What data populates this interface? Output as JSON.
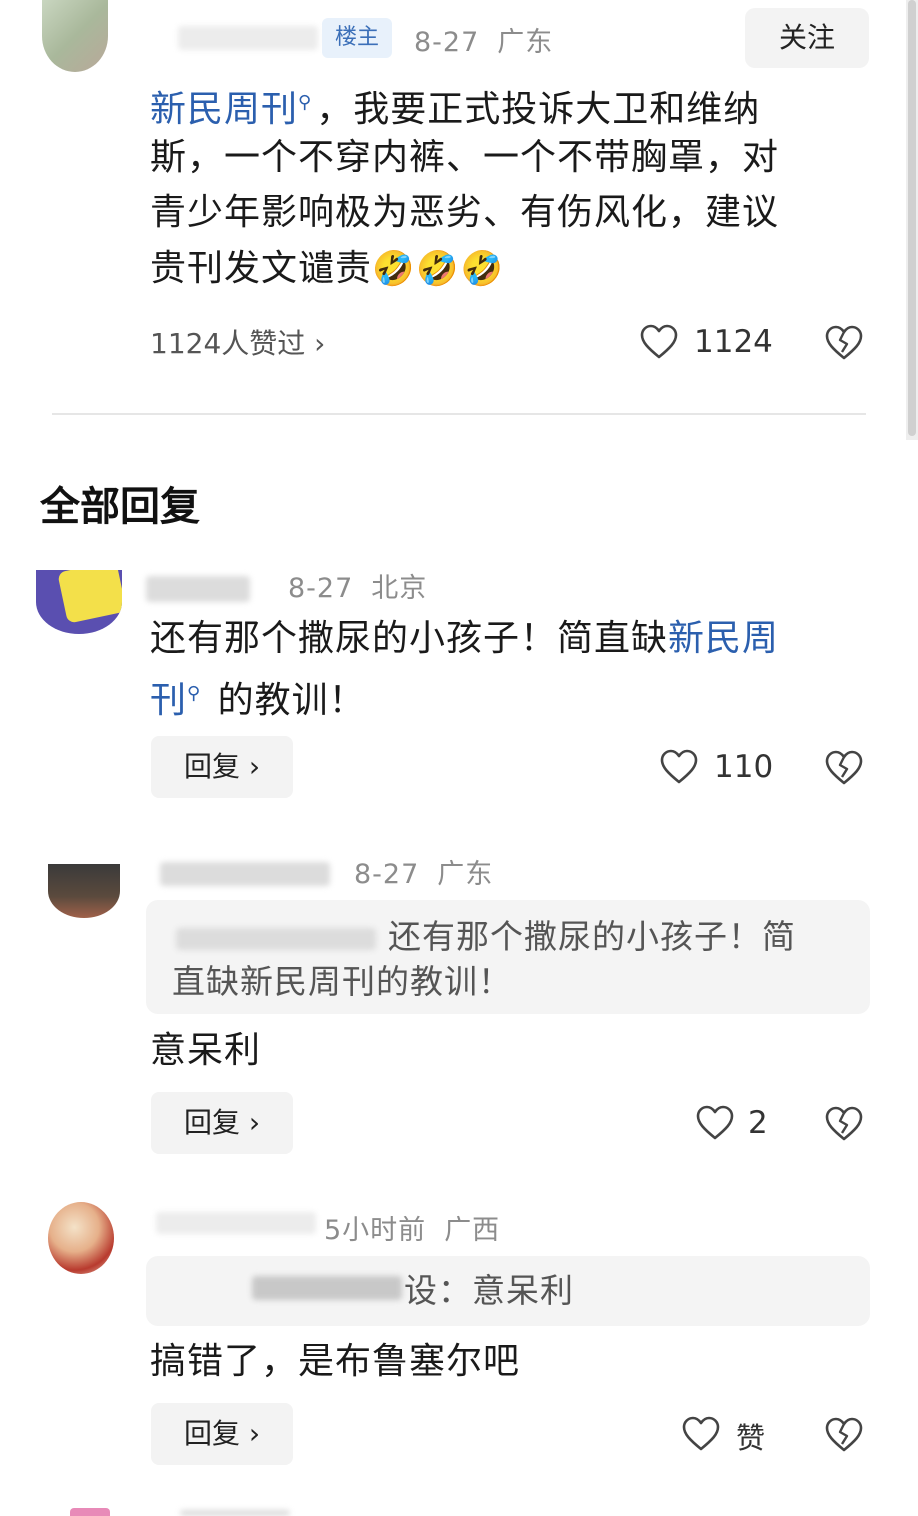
{
  "post": {
    "badge": "楼主",
    "date": "8-27",
    "location": "广东",
    "follow_label": "关注",
    "mention": "新民周刊",
    "text_after_mention": "，我要正式投诉大卫和维纳",
    "line2": "斯，一个不穿内裤、一个不带胸罩，对",
    "line3": "青少年影响极为恶劣、有伤风化，建议",
    "line4": "贵刊发文谴责",
    "emojis": "🤣🤣🤣",
    "likers_label": "1124人赞过 ›",
    "like_count": "1124"
  },
  "section_title": "全部回复",
  "replies": [
    {
      "date": "8-27",
      "location": "北京",
      "text_before": "还有那个撒尿的小孩子！简直缺",
      "mention_part1": "新民周",
      "mention_part2": "刊",
      "text_after": " 的教训！",
      "reply_label": "回复 ›",
      "like_count": "110"
    },
    {
      "date": "8-27",
      "location": "广东",
      "quote_line1": "还有那个撒尿的小孩子！简",
      "quote_line2": "直缺新民周刊的教训！",
      "text": "意呆利",
      "reply_label": "回复 ›",
      "like_count": "2"
    },
    {
      "date": "5小时前",
      "location": "广西",
      "quote_line1": "设：意呆利",
      "text": "搞错了，是布鲁塞尔吧",
      "reply_label": "回复 ›",
      "like_count": "赞"
    }
  ],
  "icons": {
    "like": "heart-outline-icon",
    "dislike": "broken-heart-icon",
    "search": "search-lens-icon"
  },
  "colors": {
    "link": "#2b5fae",
    "badge_bg": "#e8f1fb",
    "meta": "#8c8c8c"
  }
}
